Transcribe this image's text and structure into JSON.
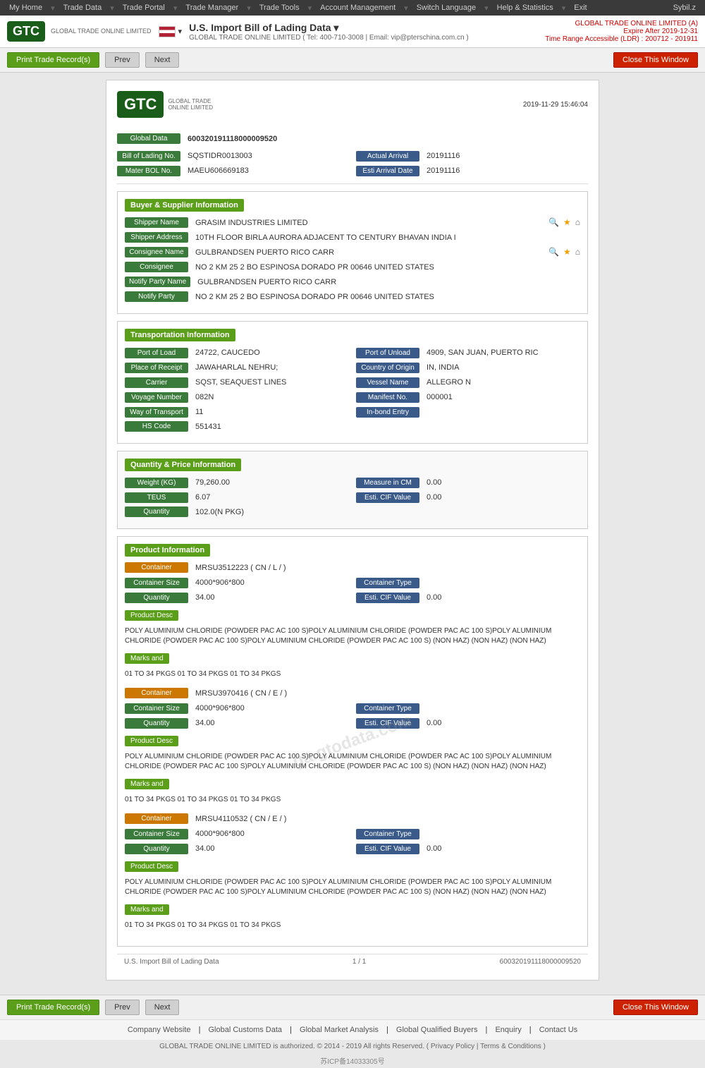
{
  "nav": {
    "items": [
      "My Home",
      "Trade Data",
      "Trade Portal",
      "Trade Manager",
      "Trade Tools",
      "Account Management",
      "Switch Language",
      "Help & Statistics",
      "Exit"
    ],
    "user": "Sybil.z"
  },
  "header": {
    "logo_text": "GTC",
    "logo_sub": "GLOBAL TRADE ONLINE LIMITED",
    "flag_label": "US",
    "title": "U.S. Import Bill of Lading Data",
    "subtitle": "GLOBAL TRADE ONLINE LIMITED ( Tel: 400-710-3008 | Email: vip@pterschina.com.cn )",
    "right_company": "GLOBAL TRADE ONLINE LIMITED (A)",
    "right_expire": "Expire After 2019-12-31",
    "right_range": "Time Range Accessible (LDR) : 200712 - 201911"
  },
  "toolbar": {
    "print_label": "Print Trade Record(s)",
    "prev_label": "Prev",
    "next_label": "Next",
    "close_label": "Close This Window"
  },
  "document": {
    "timestamp": "2019-11-29 15:46:04",
    "global_data_label": "Global Data",
    "global_data_value": "600320191118000009520",
    "bol_label": "Bill of Lading No.",
    "bol_value": "SQSTIDR0013003",
    "actual_arrival_label": "Actual Arrival",
    "actual_arrival_value": "20191116",
    "master_bol_label": "Mater BOL No.",
    "master_bol_value": "MAEU606669183",
    "esti_arrival_label": "Esti Arrival Date",
    "esti_arrival_value": "20191116",
    "buyer_section_label": "Buyer & Supplier Information",
    "shipper_name_label": "Shipper Name",
    "shipper_name_value": "GRASIM INDUSTRIES LIMITED",
    "shipper_address_label": "Shipper Address",
    "shipper_address_value": "10TH FLOOR BIRLA AURORA ADJACENT TO CENTURY BHAVAN INDIA I",
    "consignee_name_label": "Consignee Name",
    "consignee_name_value": "GULBRANDSEN PUERTO RICO CARR",
    "consignee_label": "Consignee",
    "consignee_value": "NO 2 KM 25 2 BO ESPINOSA DORADO PR 00646 UNITED STATES",
    "notify_party_name_label": "Notify Party Name",
    "notify_party_name_value": "GULBRANDSEN PUERTO RICO CARR",
    "notify_party_label": "Notify Party",
    "notify_party_value": "NO 2 KM 25 2 BO ESPINOSA DORADO PR 00646 UNITED STATES",
    "transport_section_label": "Transportation Information",
    "port_load_label": "Port of Load",
    "port_load_value": "24722, CAUCEDO",
    "port_unload_label": "Port of Unload",
    "port_unload_value": "4909, SAN JUAN, PUERTO RIC",
    "place_receipt_label": "Place of Receipt",
    "place_receipt_value": "JAWAHARLAL NEHRU;",
    "country_origin_label": "Country of Origin",
    "country_origin_value": "IN, INDIA",
    "carrier_label": "Carrier",
    "carrier_value": "SQST, SEAQUEST LINES",
    "vessel_name_label": "Vessel Name",
    "vessel_name_value": "ALLEGRO N",
    "voyage_number_label": "Voyage Number",
    "voyage_number_value": "082N",
    "manifest_label": "Manifest No.",
    "manifest_value": "000001",
    "way_transport_label": "Way of Transport",
    "way_transport_value": "11",
    "inbond_label": "In-bond Entry",
    "inbond_value": "",
    "hs_code_label": "HS Code",
    "hs_code_value": "551431",
    "quantity_section_label": "Quantity & Price Information",
    "weight_label": "Weight (KG)",
    "weight_value": "79,260.00",
    "measure_cm_label": "Measure in CM",
    "measure_cm_value": "0.00",
    "teus_label": "TEUS",
    "teus_value": "6.07",
    "esti_cif_label": "Esti. CIF Value",
    "esti_cif_value": "0.00",
    "quantity_label": "Quantity",
    "quantity_value": "102.0(N PKG)",
    "product_section_label": "Product Information",
    "watermark": "ga.gtodata.com",
    "containers": [
      {
        "id": "container-1",
        "label": "Container",
        "value": "MRSU3512223 ( CN / L / )",
        "size_label": "Container Size",
        "size_value": "4000*906*800",
        "type_label": "Container Type",
        "type_value": "",
        "qty_label": "Quantity",
        "qty_value": "34.00",
        "cif_label": "Esti. CIF Value",
        "cif_value": "0.00",
        "desc_label": "Product Desc",
        "desc_value": "POLY ALUMINIUM CHLORIDE (POWDER PAC AC 100 S)POLY ALUMINIUM CHLORIDE (POWDER PAC AC 100 S)POLY ALUMINIUM CHLORIDE (POWDER PAC AC 100 S)POLY ALUMINIUM CHLORIDE (POWDER PAC AC 100 S) (NON HAZ) (NON HAZ) (NON HAZ)",
        "marks_label": "Marks and",
        "marks_value": "01 TO 34 PKGS 01 TO 34 PKGS 01 TO 34 PKGS"
      },
      {
        "id": "container-2",
        "label": "Container",
        "value": "MRSU3970416 ( CN / E / )",
        "size_label": "Container Size",
        "size_value": "4000*906*800",
        "type_label": "Container Type",
        "type_value": "",
        "qty_label": "Quantity",
        "qty_value": "34.00",
        "cif_label": "Esti. CIF Value",
        "cif_value": "0.00",
        "desc_label": "Product Desc",
        "desc_value": "POLY ALUMINIUM CHLORIDE (POWDER PAC AC 100 S)POLY ALUMINIUM CHLORIDE (POWDER PAC AC 100 S)POLY ALUMINIUM CHLORIDE (POWDER PAC AC 100 S)POLY ALUMINIUM CHLORIDE (POWDER PAC AC 100 S) (NON HAZ) (NON HAZ) (NON HAZ)",
        "marks_label": "Marks and",
        "marks_value": "01 TO 34 PKGS 01 TO 34 PKGS 01 TO 34 PKGS"
      },
      {
        "id": "container-3",
        "label": "Container",
        "value": "MRSU4110532 ( CN / E / )",
        "size_label": "Container Size",
        "size_value": "4000*906*800",
        "type_label": "Container Type",
        "type_value": "",
        "qty_label": "Quantity",
        "qty_value": "34.00",
        "cif_label": "Esti. CIF Value",
        "cif_value": "0.00",
        "desc_label": "Product Desc",
        "desc_value": "POLY ALUMINIUM CHLORIDE (POWDER PAC AC 100 S)POLY ALUMINIUM CHLORIDE (POWDER PAC AC 100 S)POLY ALUMINIUM CHLORIDE (POWDER PAC AC 100 S)POLY ALUMINIUM CHLORIDE (POWDER PAC AC 100 S) (NON HAZ) (NON HAZ) (NON HAZ)",
        "marks_label": "Marks and",
        "marks_value": "01 TO 34 PKGS 01 TO 34 PKGS 01 TO 34 PKGS"
      }
    ],
    "page_footer_left": "U.S. Import Bill of Lading Data",
    "page_footer_mid": "1 / 1",
    "page_footer_right": "600320191118000009520"
  },
  "bottom_toolbar": {
    "print_label": "Print Trade Record(s)",
    "prev_label": "Prev",
    "next_label": "Next",
    "close_label": "Close This Window"
  },
  "footer": {
    "links": [
      "Company Website",
      "Global Customs Data",
      "Global Market Analysis",
      "Global Qualified Buyers",
      "Enquiry",
      "Contact Us"
    ],
    "copyright": "GLOBAL TRADE ONLINE LIMITED is authorized. © 2014 - 2019 All rights Reserved.  (  Privacy Policy  |  Terms & Conditions  )",
    "icp": "苏ICP备14033305号"
  }
}
